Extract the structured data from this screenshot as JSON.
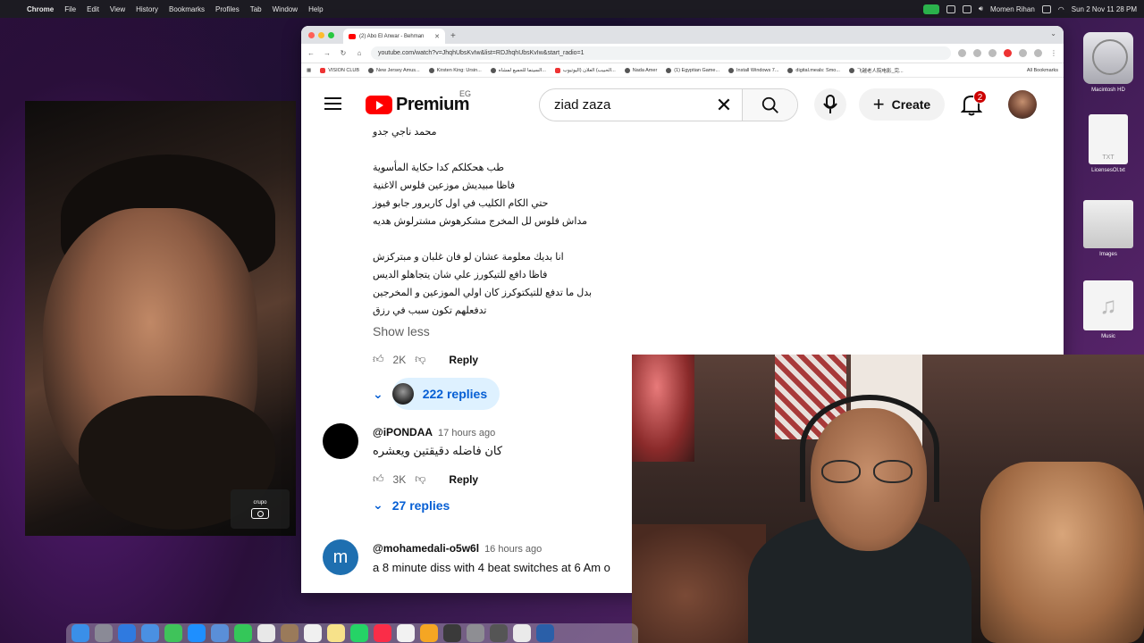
{
  "menubar": {
    "app": "Chrome",
    "items": [
      "File",
      "Edit",
      "View",
      "History",
      "Bookmarks",
      "Profiles",
      "Tab",
      "Window",
      "Help"
    ],
    "user": "Momen Rihan",
    "datetime": "Sun 2 Nov  11 28 PM"
  },
  "chrome": {
    "tab_title": "(2) Abo El Anwar - Behman",
    "url": "youtube.com/watch?v=JhqhUbsKvIw&list=RDJhqhUbsKvIw&start_radio=1",
    "bookmarks": [
      "VISION CLUB",
      "New Jersey Amus...",
      "Kirsten King: Ursin...",
      "السينما للجميع لمشاه...",
      "الحبيب) العلان (اليوتيوب...",
      "Nada Amer",
      "(1) Egyptian Game...",
      "Install Windows 7...",
      "digital.meals: Smo...",
      "飞越老人院电影_完..."
    ],
    "all_bookmarks": "All Bookmarks"
  },
  "youtube": {
    "logo": "Premium",
    "region": "EG",
    "search_value": "ziad zaza",
    "create_label": "Create",
    "notif_count": "2"
  },
  "comments": {
    "expanded_lines": [
      "محمد ناجي جدو",
      "طب هحكلكم كدا حكاية المأسوية",
      "فاظا مبيديش موزعين فلوس الاغنية",
      "حتي الكام الكليب في اول كاريرور جابو فيوز",
      "مداش فلوس لل المخرج مشكرهوش مشترلوش هديه",
      "انا بديك معلومة عشان لو فان غلبان و مبتركزش",
      "فاظا دافع للتيكورز علي شان يتجاهلو الديس",
      "بدل ما تدفع للتيكتوكرز كان اولي الموزعين و المخرجين",
      "تدفعلهم تكون سبب في رزق"
    ],
    "show_less": "Show less",
    "first_likes": "2K",
    "reply_label": "Reply",
    "first_replies": "222 replies",
    "second": {
      "handle": "@iPONDAA",
      "time": "17 hours ago",
      "text": "كان فاضله دقيقتين ويعشره",
      "likes": "3K",
      "replies": "27 replies"
    },
    "third": {
      "handle": "@mohamedali-o5w6l",
      "time": "16 hours ago",
      "avatar_letter": "m",
      "text": "a 8 minute diss with 4 beat switches at 6 Am o"
    }
  },
  "overlay": {
    "label": "crupo"
  },
  "desktop": {
    "icons": [
      "Macintosh HD",
      "LicensesOl.txt",
      "Images",
      "Music"
    ],
    "txt_label": "TXT"
  },
  "colors": {
    "yt_red": "#ff0000",
    "link_blue": "#065fd4",
    "reply_pill": "#def1ff"
  }
}
